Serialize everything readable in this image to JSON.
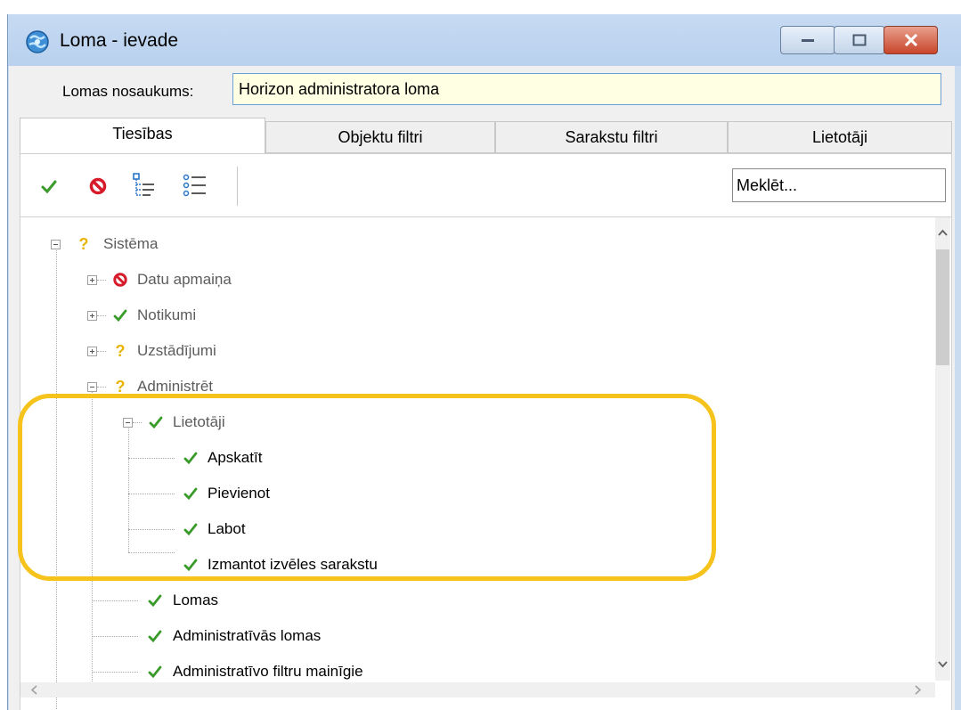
{
  "window": {
    "title": "Loma - ievade"
  },
  "form": {
    "name_label": "Lomas nosaukums:",
    "name_value": "Horizon administratora loma"
  },
  "tabs": [
    {
      "label": "Tiesības",
      "active": true
    },
    {
      "label": "Objektu filtri",
      "active": false
    },
    {
      "label": "Sarakstu filtri",
      "active": false
    },
    {
      "label": "Lietotāji",
      "active": false
    }
  ],
  "toolbar": {
    "icons": [
      "check-icon",
      "deny-icon",
      "expand-tree-icon",
      "collapse-tree-icon"
    ],
    "search_value": "Meklēt..."
  },
  "tree": {
    "nodes": [
      {
        "label": "Sistēma",
        "status": "partial",
        "expander": "minus"
      },
      {
        "label": "Datu apmaiņa",
        "status": "denied",
        "expander": "plus"
      },
      {
        "label": "Notikumi",
        "status": "allowed",
        "expander": "plus"
      },
      {
        "label": "Uzstādījumi",
        "status": "partial",
        "expander": "plus"
      },
      {
        "label": "Administrēt",
        "status": "partial",
        "expander": "minus"
      },
      {
        "label": "Lietotāji",
        "status": "allowed",
        "expander": "minus"
      },
      {
        "label": "Apskatīt",
        "status": "allowed",
        "expander": "none"
      },
      {
        "label": "Pievienot",
        "status": "allowed",
        "expander": "none"
      },
      {
        "label": "Labot",
        "status": "allowed",
        "expander": "none"
      },
      {
        "label": "Izmantot izvēles sarakstu",
        "status": "allowed",
        "expander": "none"
      },
      {
        "label": "Lomas",
        "status": "allowed",
        "expander": "none"
      },
      {
        "label": "Administratīvās lomas",
        "status": "allowed",
        "expander": "none"
      },
      {
        "label": "Administratīvo filtru mainīgie",
        "status": "allowed",
        "expander": "none"
      }
    ]
  },
  "colors": {
    "highlight": "#f6c21c",
    "allowed": "#3a9a2a",
    "denied": "#d61b2a",
    "partial": "#e8b400"
  }
}
